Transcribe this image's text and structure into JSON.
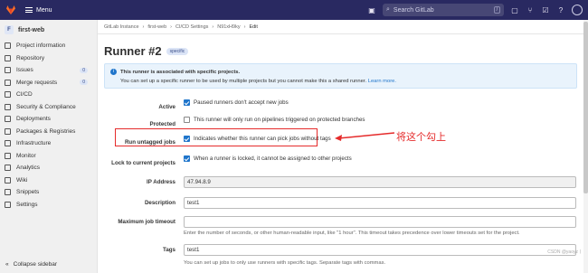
{
  "topbar": {
    "menu_label": "Menu",
    "search_placeholder": "Search GitLab",
    "search_shortcut": "/"
  },
  "sidebar": {
    "project_initial": "F",
    "project_name": "first-web",
    "items": [
      {
        "label": "Project information",
        "icon": "info-icon"
      },
      {
        "label": "Repository",
        "icon": "repo-icon"
      },
      {
        "label": "Issues",
        "icon": "issues-icon",
        "badge": "0"
      },
      {
        "label": "Merge requests",
        "icon": "merge-icon",
        "badge": "0"
      },
      {
        "label": "CI/CD",
        "icon": "rocket-icon"
      },
      {
        "label": "Security & Compliance",
        "icon": "shield-icon"
      },
      {
        "label": "Deployments",
        "icon": "deploy-icon"
      },
      {
        "label": "Packages & Registries",
        "icon": "package-icon"
      },
      {
        "label": "Infrastructure",
        "icon": "cloud-icon"
      },
      {
        "label": "Monitor",
        "icon": "monitor-icon"
      },
      {
        "label": "Analytics",
        "icon": "chart-icon"
      },
      {
        "label": "Wiki",
        "icon": "book-icon"
      },
      {
        "label": "Snippets",
        "icon": "snippet-icon"
      },
      {
        "label": "Settings",
        "icon": "gear-icon"
      }
    ],
    "collapse_label": "Collapse sidebar"
  },
  "breadcrumb": [
    "GitLab Instance",
    "first-web",
    "CI/CD Settings",
    "N91xH9ky",
    "Edit"
  ],
  "page": {
    "title": "Runner #2",
    "badge": "specific"
  },
  "alert": {
    "line1": "This runner is associated with specific projects.",
    "line2": "You can set up a specific runner to be used by multiple projects but you cannot make this a shared runner.",
    "learn_more": "Learn more."
  },
  "form": {
    "active_label": "Active",
    "active_text": "Paused runners don't accept new jobs",
    "protected_label": "Protected",
    "protected_text": "This runner will only run on pipelines triggered on protected branches",
    "untagged_label": "Run untagged jobs",
    "untagged_text": "Indicates whether this runner can pick jobs without tags",
    "lock_label": "Lock to current projects",
    "lock_text": "When a runner is locked, it cannot be assigned to other projects",
    "ip_label": "IP Address",
    "ip_value": "47.94.8.9",
    "description_label": "Description",
    "description_value": "test1",
    "timeout_label": "Maximum job timeout",
    "timeout_hint": "Enter the number of seconds, or other human-readable input, like \"1 hour\". This timeout takes precedence over lower timeouts set for the project.",
    "tags_label": "Tags",
    "tags_value": "test1",
    "tags_hint": "You can set up jobs to only use runners with specific tags. Separate tags with commas."
  },
  "annotation": {
    "text": "将这个勾上",
    "color": "#e52b2b"
  },
  "watermark": "CSDN @yaoyz丨",
  "colors": {
    "topbar": "#292961",
    "accent": "#1f75cb"
  }
}
